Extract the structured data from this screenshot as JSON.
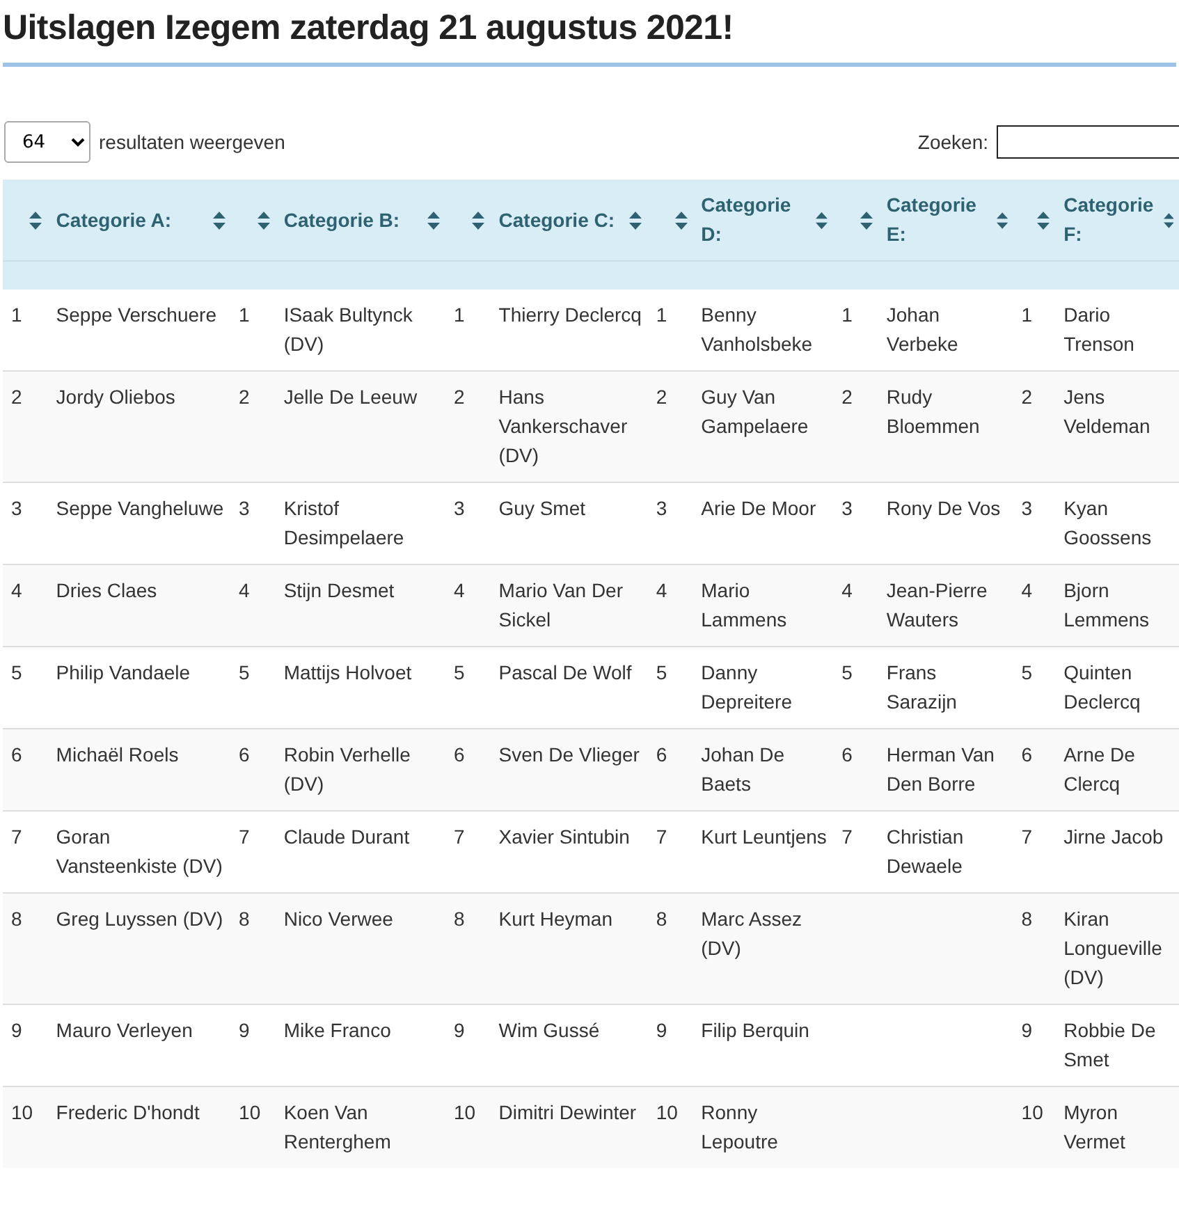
{
  "title": "Uitslagen Izegem zaterdag 21 augustus 2021!",
  "length_select": {
    "value": "64",
    "label": "resultaten weergeven"
  },
  "search": {
    "label": "Zoeken:"
  },
  "table": {
    "columns": [
      "Categorie A:",
      "Categorie B:",
      "Categorie C:",
      "Categorie D:",
      "Categorie E:",
      "Categorie F:"
    ],
    "rows": [
      [
        {
          "rank": "1",
          "name": "Seppe Verschuere"
        },
        {
          "rank": "1",
          "name": "ISaak Bultynck (DV)"
        },
        {
          "rank": "1",
          "name": "Thierry Declercq"
        },
        {
          "rank": "1",
          "name": "Benny Vanholsbeke"
        },
        {
          "rank": "1",
          "name": "Johan Verbeke"
        },
        {
          "rank": "1",
          "name": "Dario Trenson"
        }
      ],
      [
        {
          "rank": "2",
          "name": "Jordy Oliebos"
        },
        {
          "rank": "2",
          "name": "Jelle De Leeuw"
        },
        {
          "rank": "2",
          "name": "Hans Vankerschaver (DV)"
        },
        {
          "rank": "2",
          "name": "Guy Van Gampelaere"
        },
        {
          "rank": "2",
          "name": "Rudy Bloemmen"
        },
        {
          "rank": "2",
          "name": "Jens Veldeman"
        }
      ],
      [
        {
          "rank": "3",
          "name": "Seppe Vangheluwe"
        },
        {
          "rank": "3",
          "name": "Kristof Desimpelaere"
        },
        {
          "rank": "3",
          "name": "Guy Smet"
        },
        {
          "rank": "3",
          "name": "Arie De Moor"
        },
        {
          "rank": "3",
          "name": "Rony De Vos"
        },
        {
          "rank": "3",
          "name": "Kyan Goossens"
        }
      ],
      [
        {
          "rank": "4",
          "name": "Dries Claes"
        },
        {
          "rank": "4",
          "name": "Stijn Desmet"
        },
        {
          "rank": "4",
          "name": "Mario Van Der Sickel"
        },
        {
          "rank": "4",
          "name": "Mario Lammens"
        },
        {
          "rank": "4",
          "name": "Jean-Pierre Wauters"
        },
        {
          "rank": "4",
          "name": "Bjorn Lemmens"
        }
      ],
      [
        {
          "rank": "5",
          "name": "Philip Vandaele"
        },
        {
          "rank": "5",
          "name": "Mattijs Holvoet"
        },
        {
          "rank": "5",
          "name": "Pascal De Wolf"
        },
        {
          "rank": "5",
          "name": "Danny Depreitere"
        },
        {
          "rank": "5",
          "name": "Frans Sarazijn"
        },
        {
          "rank": "5",
          "name": "Quinten Declercq"
        }
      ],
      [
        {
          "rank": "6",
          "name": "Michaël Roels"
        },
        {
          "rank": "6",
          "name": "Robin Verhelle (DV)"
        },
        {
          "rank": "6",
          "name": "Sven De Vlieger"
        },
        {
          "rank": "6",
          "name": "Johan De Baets"
        },
        {
          "rank": "6",
          "name": "Herman Van Den Borre"
        },
        {
          "rank": "6",
          "name": "Arne De Clercq"
        }
      ],
      [
        {
          "rank": "7",
          "name": "Goran Vansteenkiste (DV)"
        },
        {
          "rank": "7",
          "name": "Claude Durant"
        },
        {
          "rank": "7",
          "name": "Xavier Sintubin"
        },
        {
          "rank": "7",
          "name": "Kurt Leuntjens"
        },
        {
          "rank": "7",
          "name": "Christian Dewaele"
        },
        {
          "rank": "7",
          "name": "Jirne Jacob"
        }
      ],
      [
        {
          "rank": "8",
          "name": "Greg Luyssen (DV)"
        },
        {
          "rank": "8",
          "name": "Nico Verwee"
        },
        {
          "rank": "8",
          "name": "Kurt Heyman"
        },
        {
          "rank": "8",
          "name": "Marc Assez (DV)"
        },
        null,
        {
          "rank": "8",
          "name": "Kiran Longueville (DV)"
        }
      ],
      [
        {
          "rank": "9",
          "name": "Mauro Verleyen"
        },
        {
          "rank": "9",
          "name": "Mike Franco"
        },
        {
          "rank": "9",
          "name": "Wim Gussé"
        },
        {
          "rank": "9",
          "name": "Filip Berquin"
        },
        null,
        {
          "rank": "9",
          "name": "Robbie De Smet"
        }
      ],
      [
        {
          "rank": "10",
          "name": "Frederic D'hondt"
        },
        {
          "rank": "10",
          "name": "Koen Van Renterghem"
        },
        {
          "rank": "10",
          "name": "Dimitri Dewinter"
        },
        {
          "rank": "10",
          "name": "Ronny Lepoutre"
        },
        null,
        {
          "rank": "10",
          "name": "Myron Vermet"
        }
      ]
    ]
  }
}
